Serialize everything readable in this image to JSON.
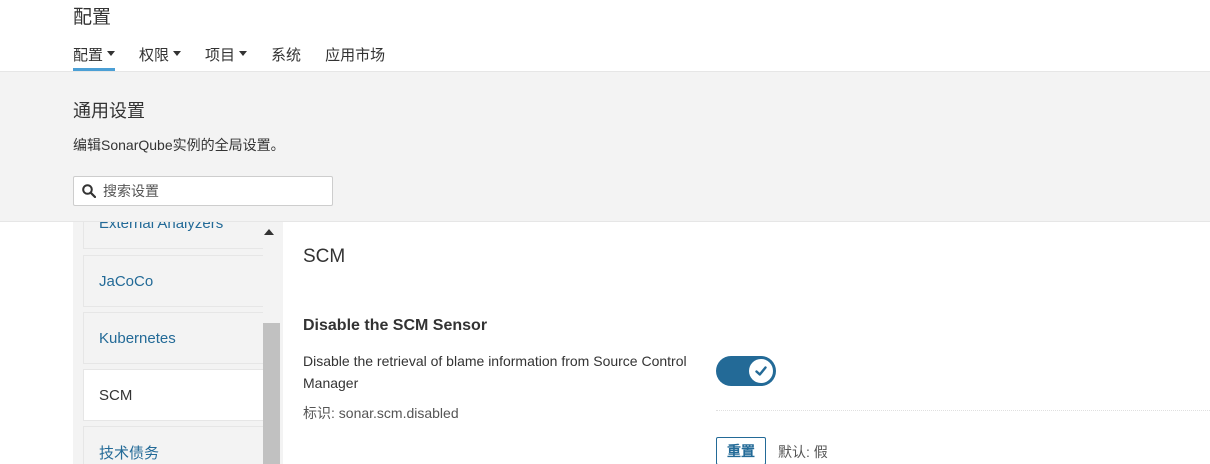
{
  "header": {
    "title": "配置",
    "nav": [
      {
        "label": "配置",
        "has_caret": true,
        "active": true
      },
      {
        "label": "权限",
        "has_caret": true
      },
      {
        "label": "项目",
        "has_caret": true
      },
      {
        "label": "系统",
        "has_caret": false
      },
      {
        "label": "应用市场",
        "has_caret": false
      }
    ]
  },
  "general": {
    "title": "通用设置",
    "description": "编辑SonarQube实例的全局设置。",
    "search_placeholder": "搜索设置"
  },
  "sidebar": {
    "items": [
      {
        "label": "External Analyzers"
      },
      {
        "label": "JaCoCo"
      },
      {
        "label": "Kubernetes"
      },
      {
        "label": "SCM",
        "active": true
      },
      {
        "label": "技术债务"
      }
    ]
  },
  "main": {
    "title": "SCM",
    "setting": {
      "name": "Disable the SCM Sensor",
      "description": "Disable the retrieval of blame information from Source Control Manager",
      "key": "标识: sonar.scm.disabled",
      "enabled": true,
      "reset_label": "重置",
      "default_text": "默认: 假"
    }
  },
  "colors": {
    "accent": "#236a97",
    "nav_underline": "#4b9fd5",
    "band_bg": "#f3f3f3"
  },
  "icons": {
    "search": "search-icon",
    "check": "check-icon",
    "caret": "caret-down-icon",
    "scroll_up": "scroll-up-arrow-icon"
  }
}
